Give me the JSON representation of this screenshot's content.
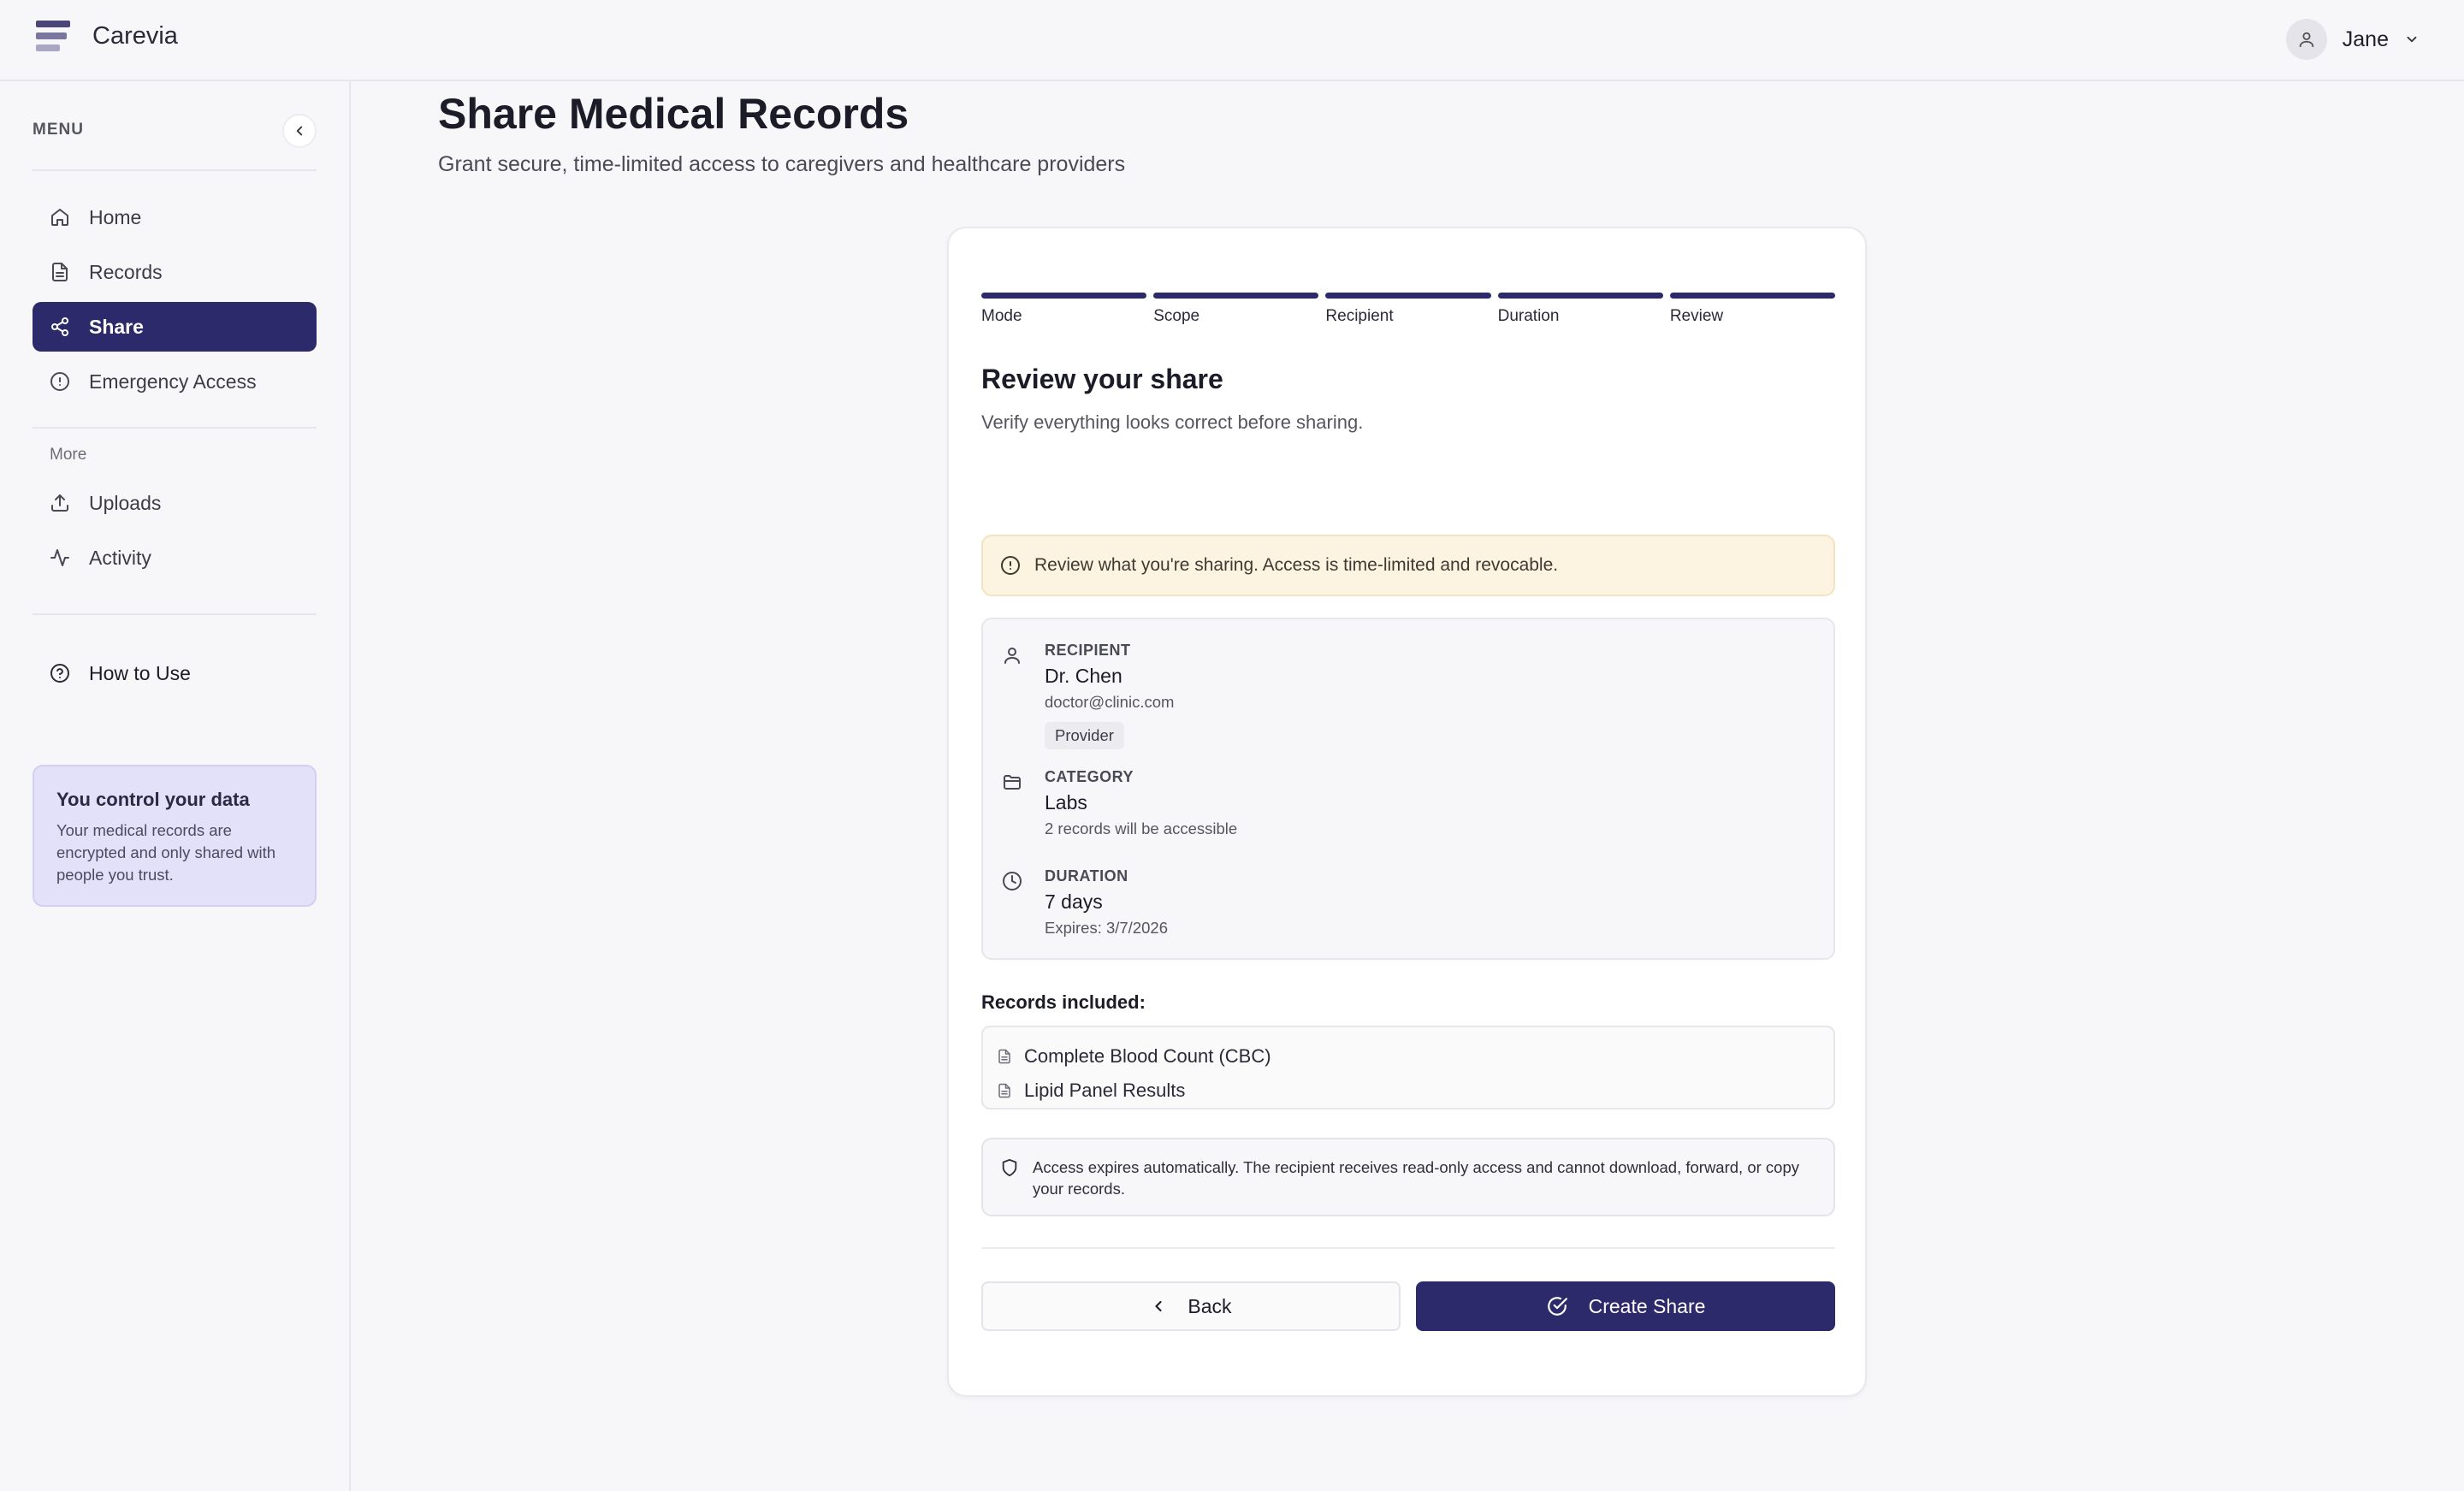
{
  "app": {
    "brand": "Carevia"
  },
  "user": {
    "name": "Jane"
  },
  "sidebar": {
    "menu_label": "MENU",
    "items": [
      {
        "label": "Home",
        "icon": "home-icon"
      },
      {
        "label": "Records",
        "icon": "document-icon"
      },
      {
        "label": "Share",
        "icon": "share-icon",
        "active": true
      },
      {
        "label": "Emergency Access",
        "icon": "alert-circle-icon"
      }
    ],
    "more_label": "More",
    "more_items": [
      {
        "label": "Uploads",
        "icon": "upload-icon"
      },
      {
        "label": "Activity",
        "icon": "activity-icon"
      }
    ],
    "help": {
      "label": "How to Use",
      "icon": "help-circle-icon"
    },
    "info_card": {
      "title": "You control your data",
      "text": "Your medical records are encrypted and only shared with people you trust."
    }
  },
  "page": {
    "title": "Share Medical Records",
    "subtitle": "Grant secure, time-limited access to caregivers and healthcare providers"
  },
  "wizard": {
    "steps": [
      "Mode",
      "Scope",
      "Recipient",
      "Duration",
      "Review"
    ],
    "current_step": 5,
    "review_title": "Review your share",
    "review_subtitle": "Verify everything looks correct before sharing.",
    "warning": "Review what you're sharing. Access is time-limited and revocable.",
    "recipient": {
      "label": "RECIPIENT",
      "name": "Dr. Chen",
      "email": "doctor@clinic.com",
      "role": "Provider"
    },
    "category": {
      "label": "CATEGORY",
      "value": "Labs",
      "detail": "2 records will be accessible"
    },
    "duration": {
      "label": "DURATION",
      "value": "7 days",
      "expires": "Expires: 3/7/2026"
    },
    "records_heading": "Records included:",
    "records": [
      "Complete Blood Count (CBC)",
      "Lipid Panel Results"
    ],
    "notice": "Access expires automatically. The recipient receives read-only access and cannot download, forward, or copy your records.",
    "back_label": "Back",
    "create_label": "Create Share"
  },
  "colors": {
    "primary": "#2d2a6b",
    "warning_bg": "#fdf3e1",
    "info_card_bg": "#e3e1fa"
  }
}
